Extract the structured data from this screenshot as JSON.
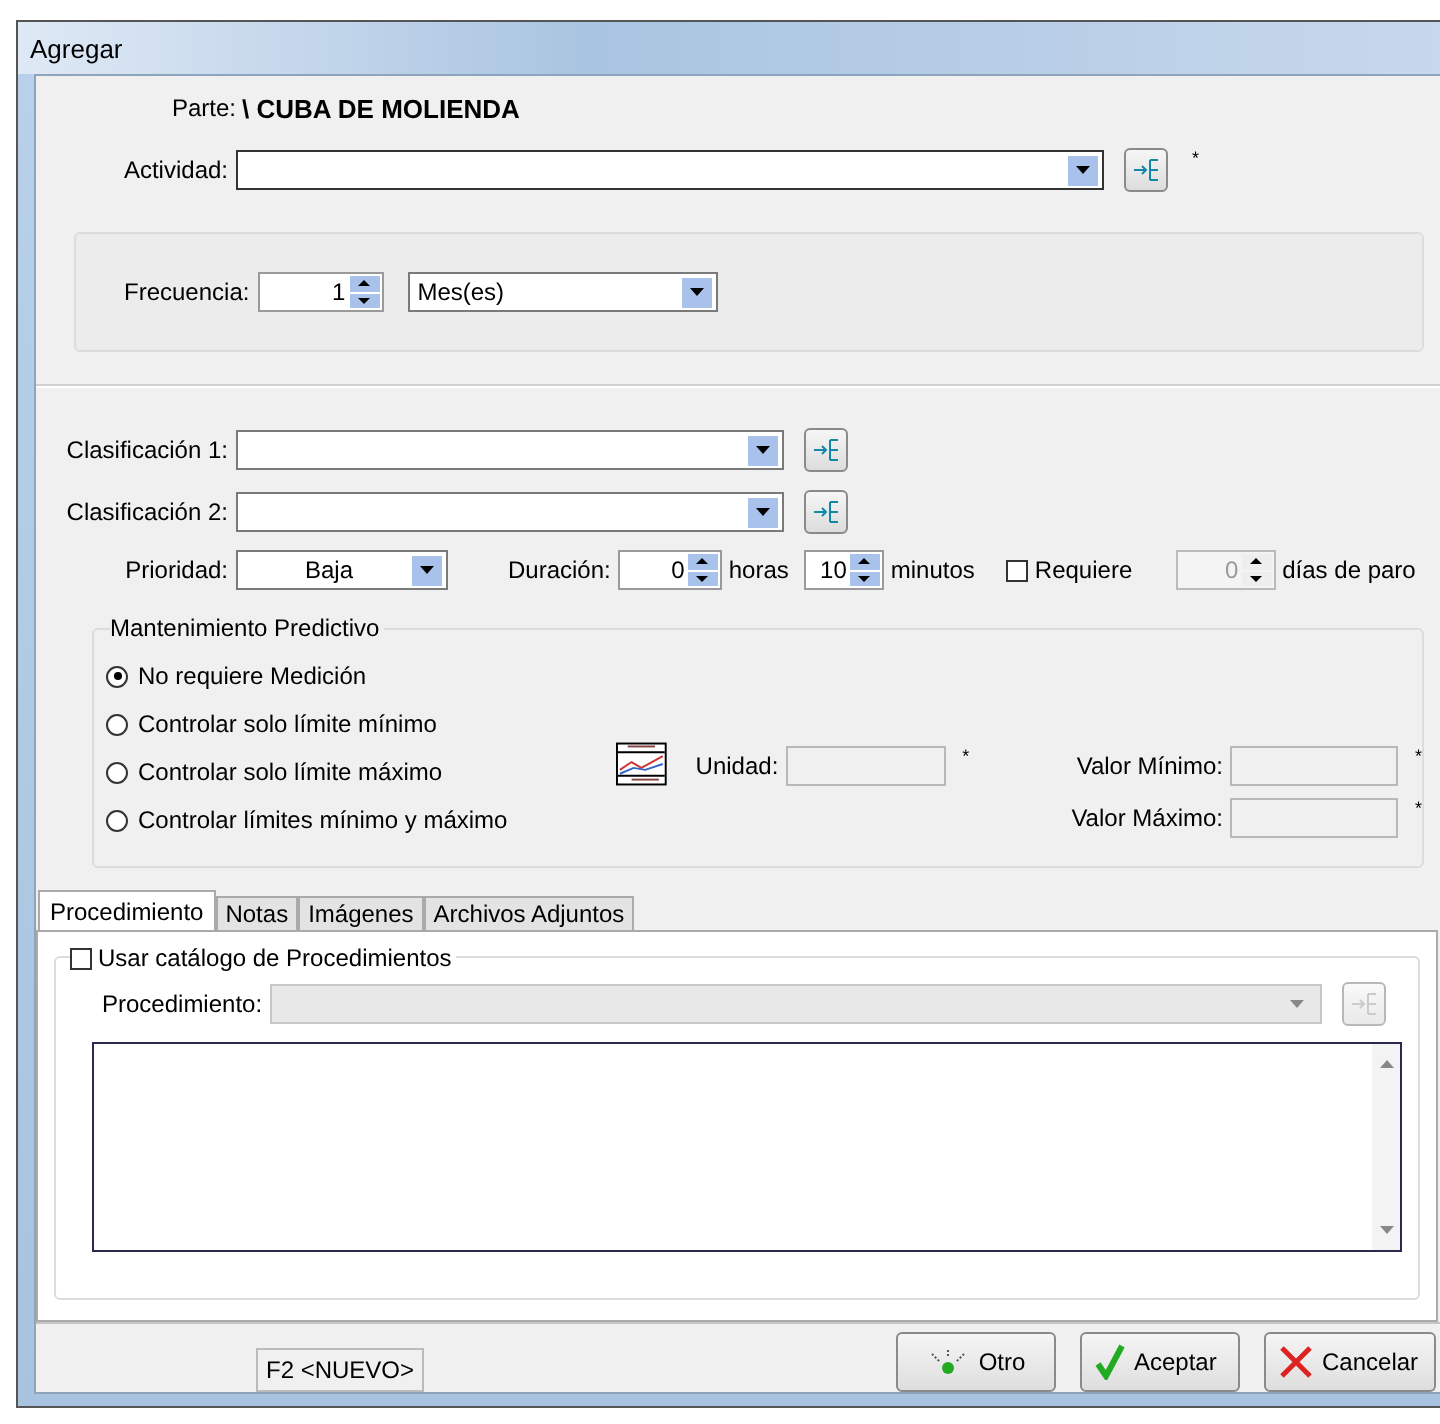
{
  "window": {
    "title": "Agregar"
  },
  "parte": {
    "label": "Parte:",
    "value": "\\ CUBA DE MOLIENDA"
  },
  "actividad": {
    "label": "Actividad:",
    "required_mark": "*"
  },
  "frecuencia": {
    "label": "Frecuencia:",
    "value": "1",
    "unit": "Mes(es)"
  },
  "clasificaciones": [
    {
      "label": "Clasificación 1:"
    },
    {
      "label": "Clasificación 2:"
    }
  ],
  "prioridad": {
    "label": "Prioridad:",
    "value": "Baja"
  },
  "duracion": {
    "label": "Duración:",
    "hours": "0",
    "hours_unit": "horas",
    "minutes": "10",
    "minutes_unit": "minutos"
  },
  "requiere": {
    "label": "Requiere",
    "checked": false,
    "days": "0",
    "days_unit": "días de paro",
    "disabled": true
  },
  "mantenimiento": {
    "title": "Mantenimiento Predictivo",
    "options": [
      {
        "label": "No requiere Medición",
        "selected": true
      },
      {
        "label": "Controlar solo límite mínimo",
        "selected": false
      },
      {
        "label": "Controlar solo límite máximo",
        "selected": false
      },
      {
        "label": "Controlar límites mínimo y máximo",
        "selected": false
      }
    ],
    "unidad": {
      "label": "Unidad:",
      "required_mark": "*"
    },
    "valor_minimo": {
      "label": "Valor Mínimo:",
      "required_mark": "*"
    },
    "valor_maximo": {
      "label": "Valor Máximo:",
      "required_mark": "*"
    }
  },
  "tabs": [
    {
      "label": "Procedimiento",
      "selected": true
    },
    {
      "label": "Notas",
      "selected": false
    },
    {
      "label": "Imágenes",
      "selected": false
    },
    {
      "label": "Archivos Adjuntos",
      "selected": false
    }
  ],
  "procedimiento": {
    "checkbox_label": "Usar catálogo de Procedimientos",
    "checked": false,
    "label": "Procedimiento:",
    "disabled": true
  },
  "status": "F2 <NUEVO>",
  "buttons": [
    {
      "label": "Otro",
      "kind": "other"
    },
    {
      "label": "Aceptar",
      "kind": "accept"
    },
    {
      "label": "Cancelar",
      "kind": "cancel"
    }
  ]
}
